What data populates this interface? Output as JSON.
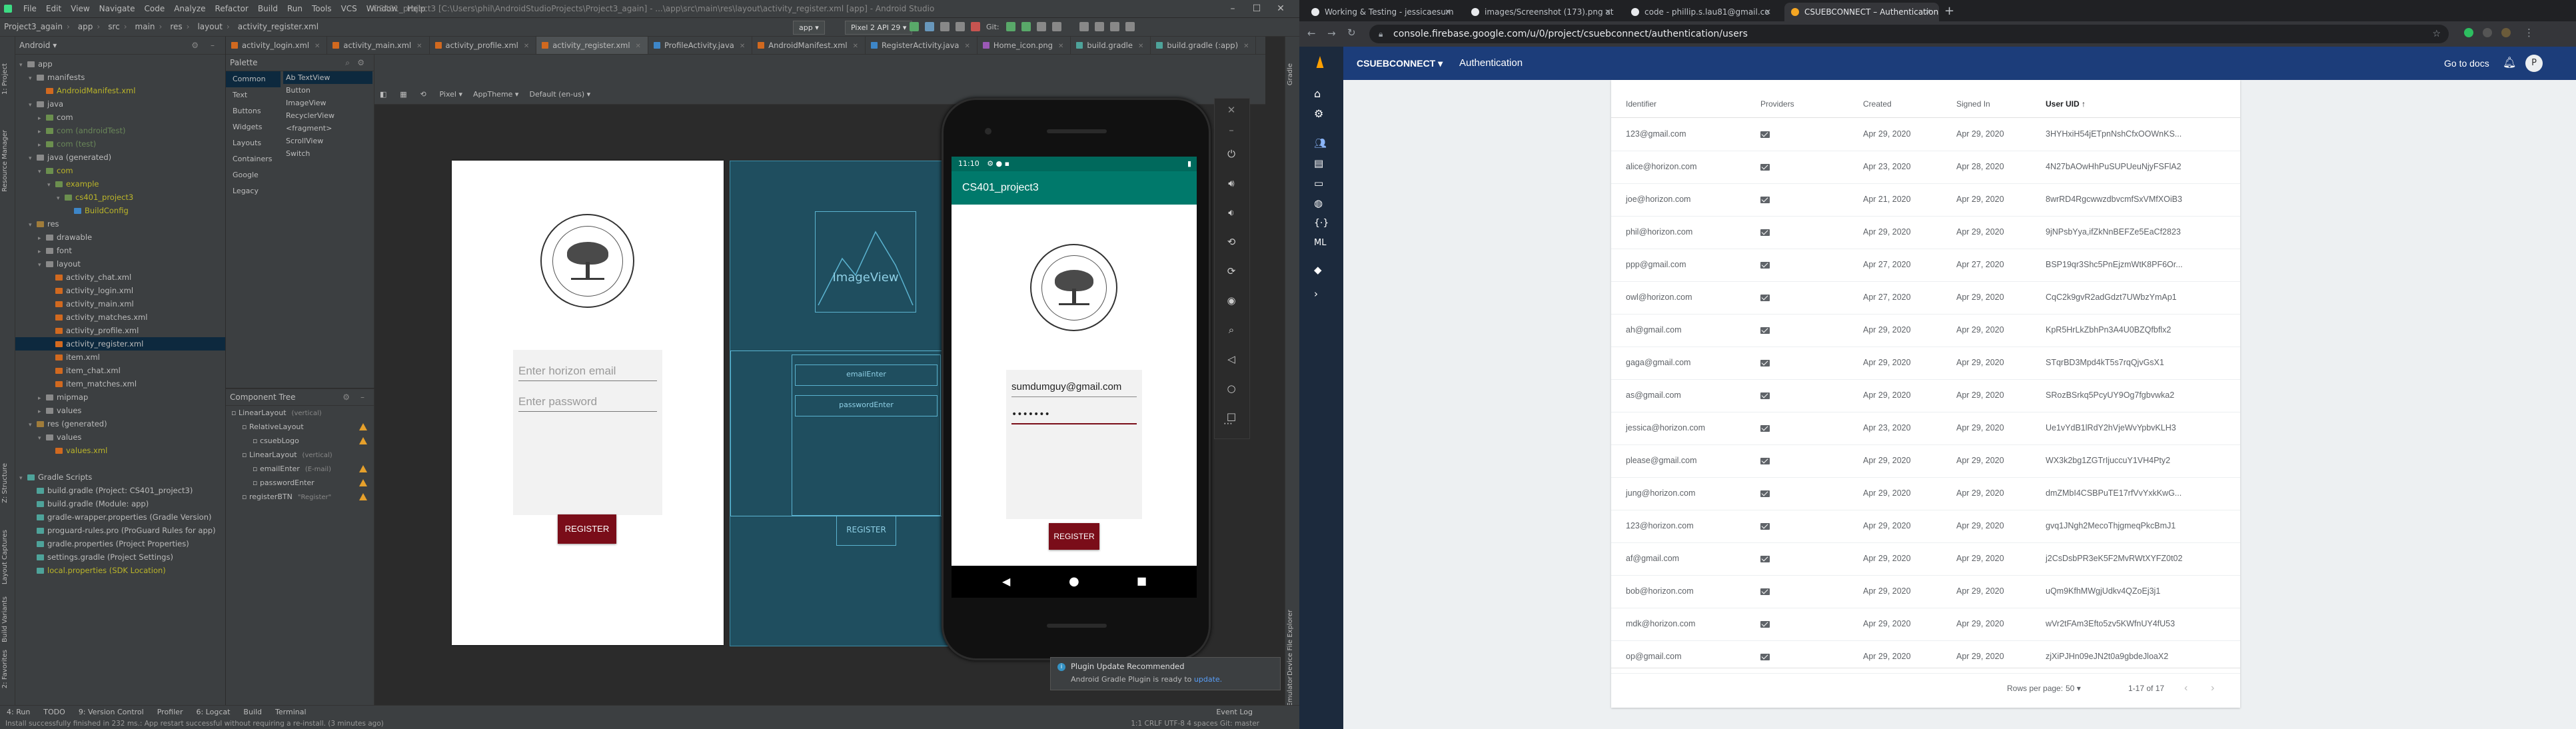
{
  "studio": {
    "window_title": "CS401_project3 [C:\\Users\\phil\\AndroidStudioProjects\\Project3_again] - ...\\app\\src\\main\\res\\layout\\activity_register.xml [app] - Android Studio",
    "menu": [
      "File",
      "Edit",
      "View",
      "Navigate",
      "Code",
      "Analyze",
      "Refactor",
      "Build",
      "Run",
      "Tools",
      "VCS",
      "Window",
      "Help"
    ],
    "breadcrumbs": [
      "Project3_again",
      "app",
      "src",
      "main",
      "res",
      "layout",
      "activity_register.xml"
    ],
    "run_config": "app",
    "device_config": "Pixel 2 API 29",
    "git_label": "Git:",
    "project_view": "Android",
    "tree": [
      {
        "indent": 0,
        "tri": "▾",
        "icon": "folder",
        "label": "app",
        "cls": ""
      },
      {
        "indent": 1,
        "tri": "▾",
        "icon": "folder",
        "label": "manifests",
        "cls": ""
      },
      {
        "indent": 2,
        "tri": "",
        "icon": "xml",
        "label": "AndroidManifest.xml",
        "cls": "c-yellow"
      },
      {
        "indent": 1,
        "tri": "▾",
        "icon": "folder",
        "label": "java",
        "cls": ""
      },
      {
        "indent": 2,
        "tri": "▸",
        "icon": "pkg",
        "label": "com",
        "cls": ""
      },
      {
        "indent": 2,
        "tri": "▸",
        "icon": "pkg",
        "label": "com (androidTest)",
        "cls": "c-green"
      },
      {
        "indent": 2,
        "tri": "▸",
        "icon": "pkg",
        "label": "com (test)",
        "cls": "c-green"
      },
      {
        "indent": 1,
        "tri": "▾",
        "icon": "folder",
        "label": "java (generated)",
        "cls": ""
      },
      {
        "indent": 2,
        "tri": "▾",
        "icon": "pkg",
        "label": "com",
        "cls": "c-yellow"
      },
      {
        "indent": 3,
        "tri": "▾",
        "icon": "pkg",
        "label": "example",
        "cls": "c-yellow"
      },
      {
        "indent": 4,
        "tri": "▾",
        "icon": "pkg",
        "label": "cs401_project3",
        "cls": "c-yellow"
      },
      {
        "indent": 5,
        "tri": "",
        "icon": "java",
        "label": "BuildConfig",
        "cls": "c-yellow"
      },
      {
        "indent": 1,
        "tri": "▾",
        "icon": "res",
        "label": "res",
        "cls": ""
      },
      {
        "indent": 2,
        "tri": "▸",
        "icon": "folder",
        "label": "drawable",
        "cls": ""
      },
      {
        "indent": 2,
        "tri": "▸",
        "icon": "folder",
        "label": "font",
        "cls": ""
      },
      {
        "indent": 2,
        "tri": "▾",
        "icon": "folder",
        "label": "layout",
        "cls": ""
      },
      {
        "indent": 3,
        "tri": "",
        "icon": "xml",
        "label": "activity_chat.xml",
        "cls": ""
      },
      {
        "indent": 3,
        "tri": "",
        "icon": "xml",
        "label": "activity_login.xml",
        "cls": ""
      },
      {
        "indent": 3,
        "tri": "",
        "icon": "xml",
        "label": "activity_main.xml",
        "cls": ""
      },
      {
        "indent": 3,
        "tri": "",
        "icon": "xml",
        "label": "activity_matches.xml",
        "cls": ""
      },
      {
        "indent": 3,
        "tri": "",
        "icon": "xml",
        "label": "activity_profile.xml",
        "cls": ""
      },
      {
        "indent": 3,
        "tri": "",
        "icon": "xml",
        "label": "activity_register.xml",
        "cls": "",
        "selected": true
      },
      {
        "indent": 3,
        "tri": "",
        "icon": "xml",
        "label": "item.xml",
        "cls": ""
      },
      {
        "indent": 3,
        "tri": "",
        "icon": "xml",
        "label": "item_chat.xml",
        "cls": ""
      },
      {
        "indent": 3,
        "tri": "",
        "icon": "xml",
        "label": "item_matches.xml",
        "cls": ""
      },
      {
        "indent": 2,
        "tri": "▸",
        "icon": "folder",
        "label": "mipmap",
        "cls": ""
      },
      {
        "indent": 2,
        "tri": "▸",
        "icon": "folder",
        "label": "values",
        "cls": ""
      },
      {
        "indent": 1,
        "tri": "▾",
        "icon": "res",
        "label": "res (generated)",
        "cls": ""
      },
      {
        "indent": 2,
        "tri": "▾",
        "icon": "folder",
        "label": "values",
        "cls": ""
      },
      {
        "indent": 3,
        "tri": "",
        "icon": "xml",
        "label": "values.xml",
        "cls": "c-yellow"
      },
      {
        "indent": 0,
        "tri": "",
        "icon": "",
        "label": "",
        "cls": ""
      },
      {
        "indent": 0,
        "tri": "▾",
        "icon": "gradle",
        "label": "Gradle Scripts",
        "cls": ""
      },
      {
        "indent": 1,
        "tri": "",
        "icon": "gradle",
        "label": "build.gradle (Project: CS401_project3)",
        "cls": ""
      },
      {
        "indent": 1,
        "tri": "",
        "icon": "gradle",
        "label": "build.gradle (Module: app)",
        "cls": ""
      },
      {
        "indent": 1,
        "tri": "",
        "icon": "gradle",
        "label": "gradle-wrapper.properties (Gradle Version)",
        "cls": ""
      },
      {
        "indent": 1,
        "tri": "",
        "icon": "gradle",
        "label": "proguard-rules.pro (ProGuard Rules for app)",
        "cls": ""
      },
      {
        "indent": 1,
        "tri": "",
        "icon": "gradle",
        "label": "gradle.properties (Project Properties)",
        "cls": ""
      },
      {
        "indent": 1,
        "tri": "",
        "icon": "gradle",
        "label": "settings.gradle (Project Settings)",
        "cls": ""
      },
      {
        "indent": 1,
        "tri": "",
        "icon": "gradle",
        "label": "local.properties (SDK Location)",
        "cls": "c-yellow"
      }
    ],
    "editor_tabs": [
      {
        "label": "activity_login.xml",
        "type": "xml"
      },
      {
        "label": "activity_main.xml",
        "type": "xml"
      },
      {
        "label": "activity_profile.xml",
        "type": "xml"
      },
      {
        "label": "activity_register.xml",
        "type": "xml",
        "active": true
      },
      {
        "label": "ProfileActivity.java",
        "type": "java"
      },
      {
        "label": "AndroidManifest.xml",
        "type": "xml"
      },
      {
        "label": "RegisterActivity.java",
        "type": "java"
      },
      {
        "label": "Home_icon.png",
        "type": "png"
      },
      {
        "label": "build.gradle",
        "type": "gradle"
      },
      {
        "label": "build.gradle (:app)",
        "type": "gradle"
      }
    ],
    "palette": {
      "title": "Palette",
      "categories": [
        "Common",
        "Text",
        "Buttons",
        "Widgets",
        "Layouts",
        "Containers",
        "Google",
        "Legacy"
      ],
      "items": [
        "Ab TextView",
        "Button",
        "ImageView",
        "RecyclerView",
        "<fragment>",
        "ScrollView",
        "Switch"
      ]
    },
    "component_tree": {
      "title": "Component Tree",
      "rows": [
        {
          "indent": 0,
          "label": "LinearLayout",
          "meta": "(vertical)",
          "warn": false
        },
        {
          "indent": 1,
          "label": "RelativeLayout",
          "meta": "",
          "warn": true
        },
        {
          "indent": 2,
          "label": "csuebLogo",
          "meta": "",
          "warn": true
        },
        {
          "indent": 1,
          "label": "LinearLayout",
          "meta": "(vertical)",
          "warn": false
        },
        {
          "indent": 2,
          "label": "emailEnter",
          "meta": "(E-mail)",
          "warn": true
        },
        {
          "indent": 2,
          "label": "passwordEnter",
          "meta": "",
          "warn": true
        },
        {
          "indent": 1,
          "label": "registerBTN",
          "meta": "\"Register\"",
          "warn": true
        }
      ]
    },
    "design_toolbar": [
      "Pixel",
      "AppTheme",
      "Default (en-us)"
    ],
    "design": {
      "email_hint": "Enter horizon email",
      "password_hint": "Enter password",
      "register": "REGISTER"
    },
    "blueprint": {
      "imageview": "ImageView",
      "email": "emailEnter",
      "password": "passwordEnter",
      "register": "REGISTER"
    },
    "emulator": {
      "time": "11:10",
      "app_title": "CS401_project3",
      "email_value": "sumdumguy@gmail.com",
      "password_value": "•••••••",
      "register": "REGISTER"
    },
    "notification": {
      "title": "Plugin Update Recommended",
      "body": "Android Gradle Plugin is ready to",
      "link": "update."
    },
    "bottom_tabs": [
      "4: Run",
      "TODO",
      "9: Version Control",
      "Profiler",
      "6: Logcat",
      "Build",
      "Terminal"
    ],
    "event_log": "Event Log",
    "status_message": "Install successfully finished in 232 ms.: App restart successful without requiring a re-install. (3 minutes ago)",
    "status_right": "1:1   CRLF   UTF-8   4 spaces   Git: master"
  },
  "chrome": {
    "tabs": [
      {
        "label": "Working & Testing - jessicaesum",
        "color": "#e8eaed"
      },
      {
        "label": "images/Screenshot (173).png at ",
        "color": "#e8eaed"
      },
      {
        "label": "code - phillip.s.lau81@gmail.co",
        "color": "#e8eaed"
      },
      {
        "label": "CSUEBCONNECT – Authentication",
        "color": "#f5a623",
        "active": true
      }
    ],
    "url": "console.firebase.google.com/u/0/project/csuebconnect/authentication/users"
  },
  "firebase": {
    "project": "CSUEBCONNECT",
    "section": "Authentication",
    "go_to_docs": "Go to docs",
    "avatar": "P",
    "columns": [
      "Identifier",
      "Providers",
      "Created",
      "Signed In",
      "User UID ↑"
    ],
    "rows": [
      [
        "123@gmail.com",
        "Apr 29, 2020",
        "Apr 29, 2020",
        "3HYHxiH54jETpnNshCfxOOWnKS..."
      ],
      [
        "alice@horizon.com",
        "Apr 23, 2020",
        "Apr 28, 2020",
        "4N27bAOwHhPuSUPUeuNjyFSFlA2"
      ],
      [
        "joe@horizon.com",
        "Apr 21, 2020",
        "Apr 29, 2020",
        "8wrRD4RgcwwzdbvcmfSxVMfXOiB3"
      ],
      [
        "phil@horizon.com",
        "Apr 29, 2020",
        "Apr 29, 2020",
        "9jNPsbYya,ifZkNnBEFZe5EaCf2823"
      ],
      [
        "ppp@gmail.com",
        "Apr 27, 2020",
        "Apr 27, 2020",
        "BSP19qr3Shc5PnEjzmWtK8PF6Or..."
      ],
      [
        "owl@horizon.com",
        "Apr 27, 2020",
        "Apr 29, 2020",
        "CqC2k9gvR2adGdzt7UWbzYmAp1"
      ],
      [
        "ah@gmail.com",
        "Apr 29, 2020",
        "Apr 29, 2020",
        "KpR5HrLkZbhPn3A4U0BZQfbflx2"
      ],
      [
        "gaga@gmail.com",
        "Apr 29, 2020",
        "Apr 29, 2020",
        "STqrBD3Mpd4kT5s7rqQjvGsX1"
      ],
      [
        "as@gmail.com",
        "Apr 29, 2020",
        "Apr 29, 2020",
        "SRozBSrkq5PcyUY9Og7fgbvwka2"
      ],
      [
        "jessica@horizon.com",
        "Apr 23, 2020",
        "Apr 29, 2020",
        "Ue1vYdB1lRdY2hVjeWvYpbvKLH3"
      ],
      [
        "please@gmail.com",
        "Apr 29, 2020",
        "Apr 29, 2020",
        "WX3k2bg1ZGTrIjuccuY1VH4Pty2"
      ],
      [
        "jung@horizon.com",
        "Apr 29, 2020",
        "Apr 29, 2020",
        "dmZMbI4CSBPuTE17rfVvYxkKwG..."
      ],
      [
        "123@horizon.com",
        "Apr 29, 2020",
        "Apr 29, 2020",
        "gvq1JNgh2MecoThjgmeqPkcBmJ1"
      ],
      [
        "af@gmail.com",
        "Apr 29, 2020",
        "Apr 29, 2020",
        "j2CsDsbPR3eK5F2MvRWtXYFZ0t02"
      ],
      [
        "bob@horizon.com",
        "Apr 29, 2020",
        "Apr 29, 2020",
        "uQm9KfhMWgjUdkv4QZoEj3j1"
      ],
      [
        "mdk@horizon.com",
        "Apr 29, 2020",
        "Apr 29, 2020",
        "wVr2tFAm3Efto5zv5KWfnUY4fU53"
      ],
      [
        "op@gmail.com",
        "Apr 29, 2020",
        "Apr 29, 2020",
        "zjXiPJHn09eJN2t0a9gbdeJloaX2"
      ]
    ],
    "rows_per_page_label": "Rows per page:",
    "rows_per_page": "50",
    "range": "1-17 of 17"
  }
}
